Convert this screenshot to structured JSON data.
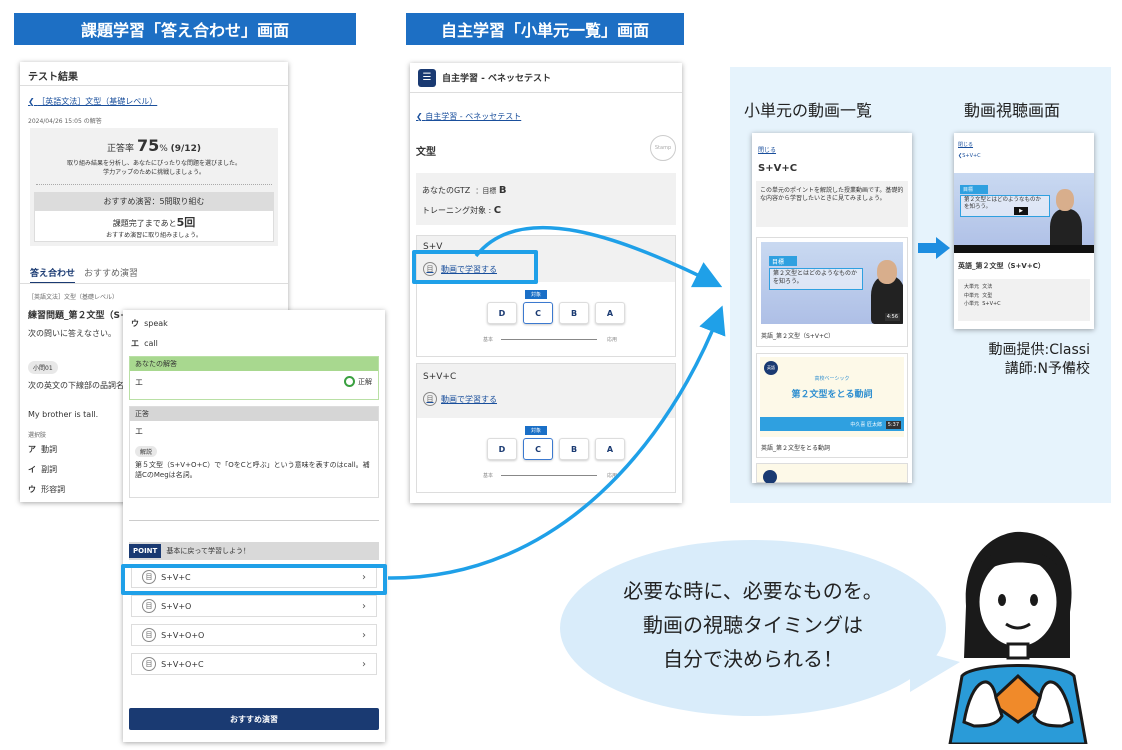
{
  "headers": {
    "left": "課題学習「答え合わせ」画面",
    "middle": "自主学習「小単元一覧」画面",
    "right_left": "小単元の動画一覧",
    "right_right": "動画視聴画面"
  },
  "phone_result": {
    "title": "テスト結果",
    "back_link": "［英語文法］文型（基礎レベル）",
    "timestamp": "2024/04/26 15:05 の解答",
    "score_prefix": "正答率",
    "score": "75",
    "score_unit": "%",
    "score_detail": "(9/12)",
    "note1": "取り組み結果を分析し、あなたにぴったりな問題を選びました。",
    "note2": "学力アップのために挑戦しましょう。",
    "recommend": "おすすめ演習：5問取り組む",
    "remain_prefix": "課題完了まであと",
    "remain_count": "5回",
    "remain_note": "おすすめ演習に取り組みましょう。",
    "tab_answers": "答え合わせ",
    "tab_recommend": "おすすめ演習",
    "crumb": "［英語文法］文型（基礎レベル）",
    "q_title": "練習問題_第２文型（S+V",
    "q_instr": "次の問いに答えなさい。",
    "q_badge": "小問01",
    "q_text": "次の英文の下線部の品詞名と",
    "q_sentence": "My brother is tall.",
    "choices_label": "選択肢",
    "choices": [
      {
        "key": "ア",
        "label": "動詞"
      },
      {
        "key": "イ",
        "label": "副詞"
      },
      {
        "key": "ウ",
        "label": "形容詞"
      }
    ]
  },
  "phone_detail": {
    "opt_w_key": "ウ",
    "opt_w_text": "speak",
    "opt_e_key": "エ",
    "opt_e_text": "call",
    "your_answer_label": "あなたの解答",
    "your_answer": "エ",
    "correct_mark": "正解",
    "correct_label": "正答",
    "correct_value": "エ",
    "expl_label": "解説",
    "explanation": "第５文型（S+V+O+C）で「OをCと呼ぶ」という意味を表すのはcall。補語CのMegは名詞。",
    "point_badge": "POINT",
    "point_text": "基本に戻って学習しよう！",
    "units": [
      "S+V+C",
      "S+V+O",
      "S+V+O+O",
      "S+V+O+C"
    ],
    "cta": "おすすめ演習"
  },
  "phone_units": {
    "app_title": "自主学習 - ベネッセテスト",
    "back": "自主学習 - ベネッセテスト",
    "section": "文型",
    "stamp": "Stamp",
    "gtz_label": "あなたのGTZ",
    "gtz_goal": "：目標",
    "gtz_value": "B",
    "train_label": "トレーニング対象",
    "train_value": "C",
    "units": [
      {
        "name": "S+V",
        "link": "動画で学習する"
      },
      {
        "name": "S+V+C",
        "link": "動画で学習する"
      }
    ],
    "target_tag": "対象",
    "grades": [
      "D",
      "C",
      "B",
      "A"
    ],
    "scale_low": "基本",
    "scale_high": "応用"
  },
  "video_list": {
    "close": "閉じる",
    "title": "S+V+C",
    "desc": "この単元のポイントを解説した授業動画です。基礎的な内容から学習したいときに見てみましょう。",
    "video_tag": "目標",
    "video_caption": "第２文型とはどのようなものかを知ろう。",
    "duration": "4:56",
    "item1": "英語_第２文型（S+V+C）",
    "card_subject": "英語",
    "card_series": "高校ベーシック",
    "card_title": "第２文型をとる動詞",
    "card_teacher": "中久喜 匠太郎",
    "duration2": "5:37",
    "item2": "英語_第２文型をとる動詞"
  },
  "video_view": {
    "close": "閉じる",
    "back": "S+V+C",
    "video_tag": "目標",
    "video_caption": "第２文型とはどのようなものかを知ろう。",
    "title": "英語_第２文型（S+V+C）",
    "meta": [
      {
        "k": "大単元",
        "v": "文法"
      },
      {
        "k": "中単元",
        "v": "文型"
      },
      {
        "k": "小単元",
        "v": "S+V+C"
      }
    ]
  },
  "credits": {
    "line1": "動画提供:Classi",
    "line2": "講師:N予備校"
  },
  "bubble": {
    "line1": "必要な時に、必要なものを。",
    "line2": "動画の視聴タイミングは",
    "line3": "自分で決められる！"
  },
  "colors": {
    "header_blue": "#1d6fc4",
    "highlight": "#1fa0e8",
    "navy": "#1a3a72",
    "panel": "#e6f3fc"
  }
}
